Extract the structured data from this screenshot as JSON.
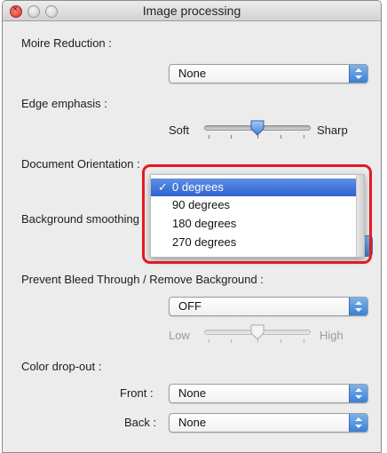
{
  "window": {
    "title": "Image processing"
  },
  "moire": {
    "label": "Moire Reduction :",
    "value": "None"
  },
  "edge": {
    "label": "Edge emphasis :",
    "min_label": "Soft",
    "max_label": "Sharp",
    "level": 0.4
  },
  "orientation": {
    "label": "Document Orientation :",
    "check": "✓",
    "options": [
      "0 degrees",
      "90 degrees",
      "180 degrees",
      "270 degrees"
    ],
    "selected": "0 degrees"
  },
  "background": {
    "label": "Background smoothing :"
  },
  "bleed": {
    "label": "Prevent Bleed Through / Remove Background :",
    "value": "OFF",
    "min_label": "Low",
    "max_label": "High",
    "level": 0.4,
    "enabled": false
  },
  "dropout": {
    "label": "Color drop-out :",
    "front_label": "Front :",
    "front_value": "None",
    "back_label": "Back :",
    "back_value": "None"
  },
  "colors": {
    "highlight": "#e11b24",
    "accent": "#3a7fd9"
  }
}
